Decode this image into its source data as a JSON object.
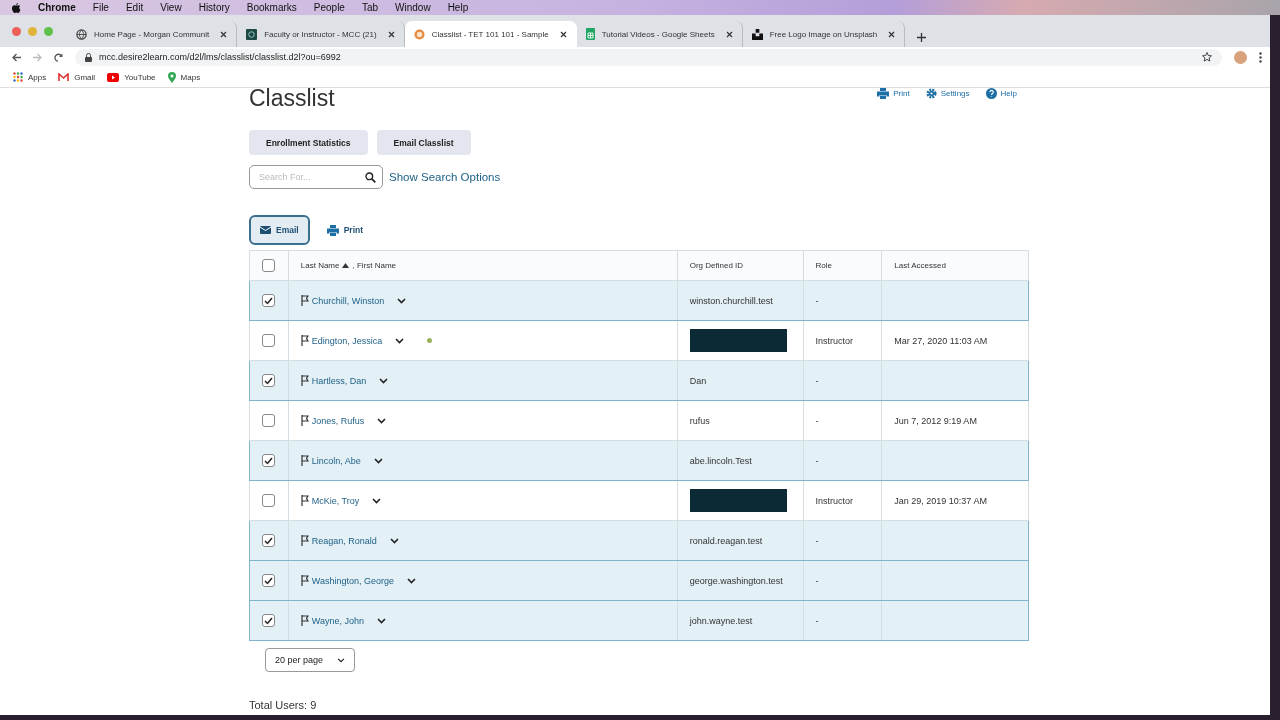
{
  "menubar": {
    "app": "Chrome",
    "menus": [
      "File",
      "Edit",
      "View",
      "History",
      "Bookmarks",
      "People",
      "Tab",
      "Window",
      "Help"
    ]
  },
  "tabs": [
    {
      "title": "Home Page - Morgan Communit",
      "selected": false
    },
    {
      "title": "Faculty or Instructor - MCC (21)",
      "selected": false
    },
    {
      "title": "Classlist - TET 101 101 - Sample",
      "selected": true
    },
    {
      "title": "Tutorial Videos - Google Sheets",
      "selected": false
    },
    {
      "title": "Free Logo Image on Unsplash",
      "selected": false
    }
  ],
  "address": "mcc.desire2learn.com/d2l/lms/classlist/classlist.d2l?ou=6992",
  "bookmarks": [
    "Apps",
    "Gmail",
    "YouTube",
    "Maps"
  ],
  "page": {
    "title": "Classlist",
    "header_links": [
      "Print",
      "Settings",
      "Help"
    ],
    "buttons": [
      "Enrollment Statistics",
      "Email Classlist"
    ],
    "search": {
      "placeholder": "Search For..."
    },
    "search_options": "Show Search Options",
    "actions": [
      {
        "label": "Email",
        "selected": true
      },
      {
        "label": "Print",
        "selected": false
      }
    ],
    "table": {
      "select_all_checked": false,
      "name_column": {
        "primary": "Last Name",
        "secondary": ", First Name"
      },
      "columns": [
        "Org Defined ID",
        "Role",
        "Last Accessed"
      ],
      "rows": [
        {
          "name": "Churchill, Winston",
          "org_id": "winston.churchill.test",
          "role": "-",
          "checked": true,
          "online": false,
          "redacted": false
        },
        {
          "name": "Edington, Jessica",
          "role": "Instructor",
          "last_accessed": "Mar 27, 2020 11:03 AM",
          "checked": false,
          "online": true,
          "redacted": true
        },
        {
          "name": "Hartless, Dan",
          "org_id": "Dan",
          "role": "-",
          "checked": true,
          "online": false,
          "redacted": false
        },
        {
          "name": "Jones, Rufus",
          "org_id": "rufus",
          "role": "-",
          "last_accessed": "Jun 7, 2012 9:19 AM",
          "checked": false,
          "online": false,
          "redacted": false
        },
        {
          "name": "Lincoln, Abe",
          "org_id": "abe.lincoln.Test",
          "role": "-",
          "checked": true,
          "online": false,
          "redacted": false
        },
        {
          "name": "McKie, Troy",
          "role": "Instructor",
          "last_accessed": "Jan 29, 2019 10:37 AM",
          "checked": false,
          "online": false,
          "redacted": true
        },
        {
          "name": "Reagan, Ronald",
          "org_id": "ronald.reagan.test",
          "role": "-",
          "checked": true,
          "online": false,
          "redacted": false
        },
        {
          "name": "Washington, George",
          "org_id": "george.washington.test",
          "role": "-",
          "checked": true,
          "online": false,
          "redacted": false
        },
        {
          "name": "Wayne, John",
          "org_id": "john.wayne.test",
          "role": "-",
          "checked": true,
          "online": false,
          "redacted": false
        }
      ]
    },
    "page_size": "20 per page",
    "total": "Total Users: 9"
  }
}
